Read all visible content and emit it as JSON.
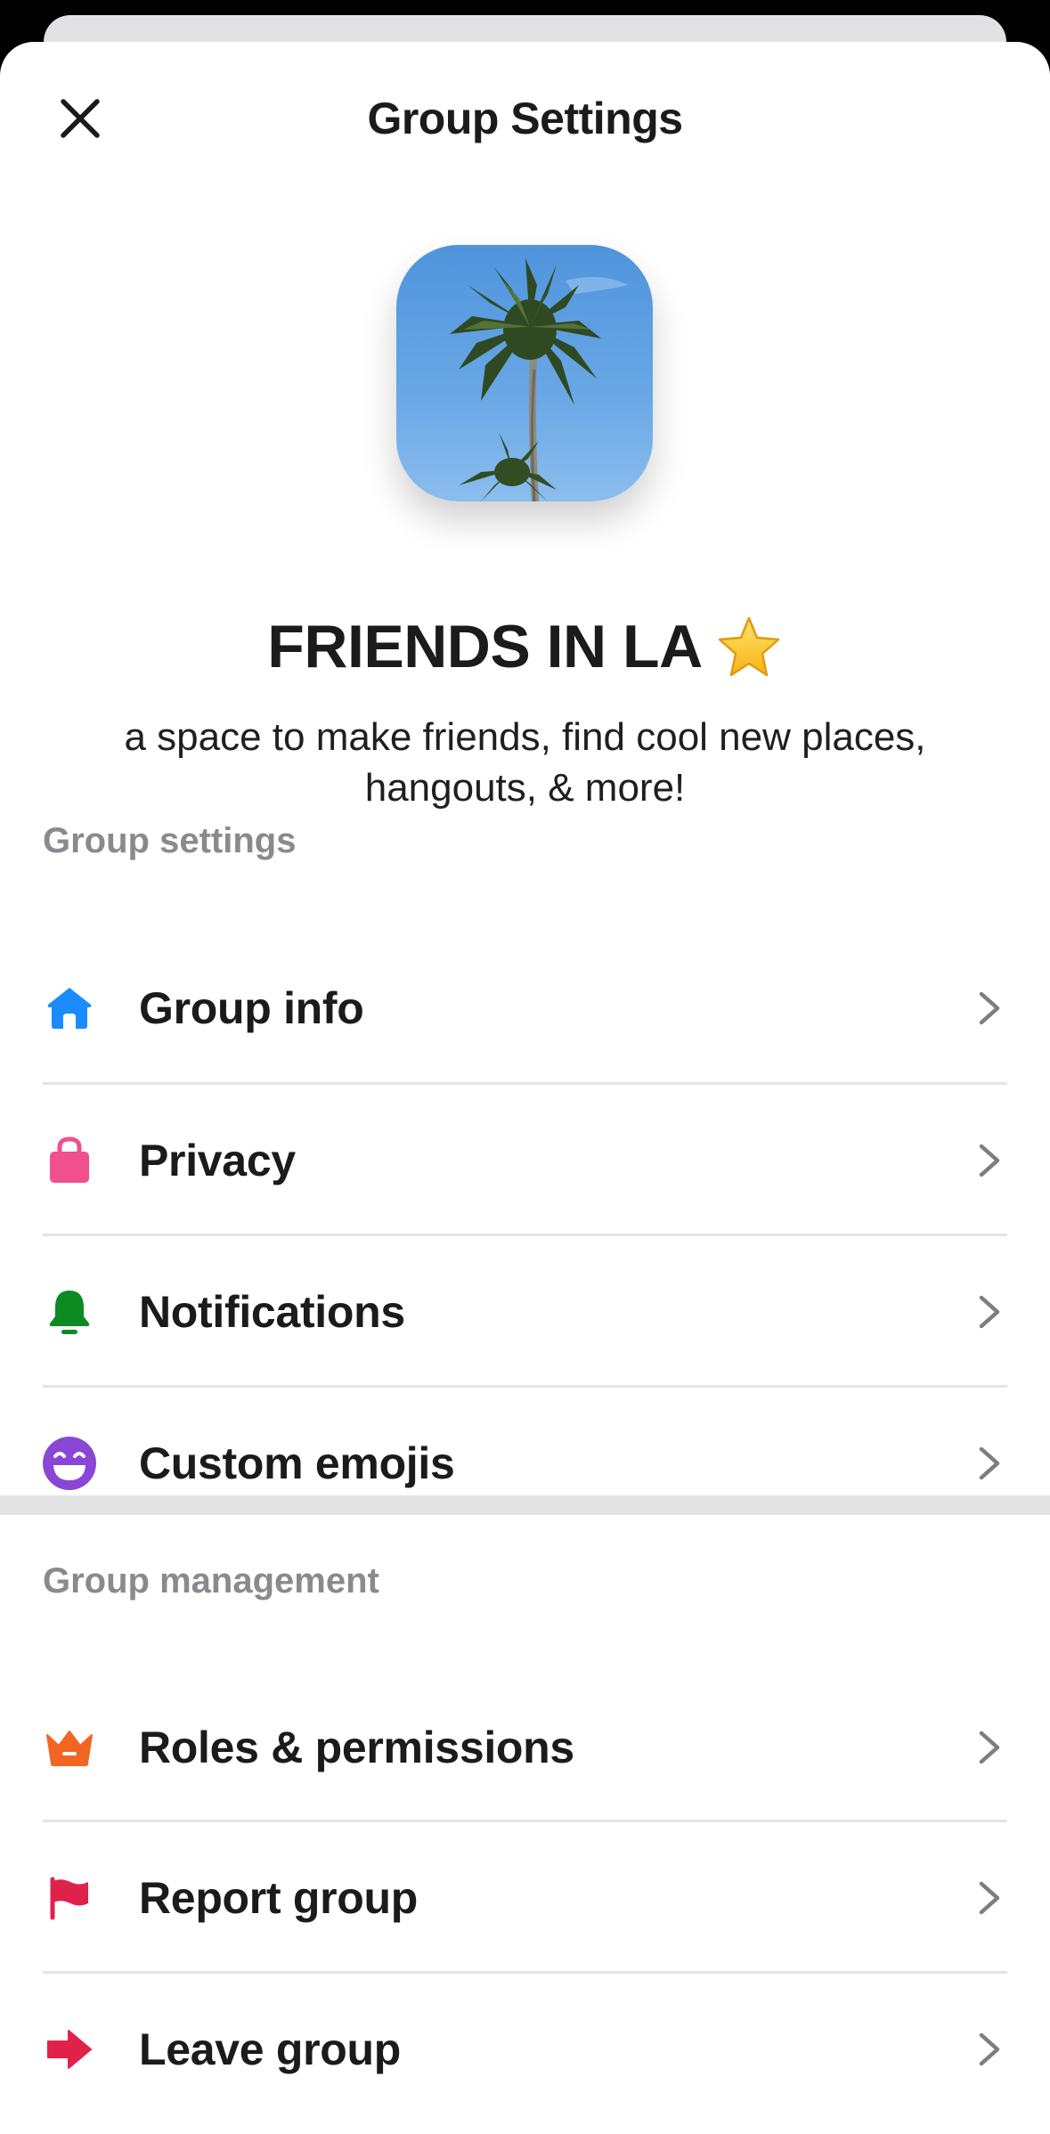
{
  "header": {
    "title": "Group Settings",
    "close_icon": "close-icon"
  },
  "group": {
    "name": "FRIENDS IN LA",
    "name_emoji": "star-icon",
    "description": "a space to make friends, find cool new places, hangouts, & more!",
    "avatar": "palm-tree-photo"
  },
  "settings_section": {
    "label": "Group settings",
    "items": [
      {
        "label": "Group info",
        "icon": "home-icon",
        "color": "#1a8cff"
      },
      {
        "label": "Privacy",
        "icon": "lock-bag-icon",
        "color": "#f0508e"
      },
      {
        "label": "Notifications",
        "icon": "bell-icon",
        "color": "#0d8a22"
      },
      {
        "label": "Custom emojis",
        "icon": "smiley-icon",
        "color": "#8a47d6"
      }
    ]
  },
  "management_section": {
    "label": "Group management",
    "items": [
      {
        "label": "Roles & permissions",
        "icon": "crown-icon",
        "color": "#f26522"
      },
      {
        "label": "Report group",
        "icon": "flag-icon",
        "color": "#e0224a"
      },
      {
        "label": "Leave group",
        "icon": "arrow-right-icon",
        "color": "#e0224a"
      }
    ]
  },
  "colors": {
    "chevron": "#7d7d82",
    "divider": "#e4e4e6",
    "section_label": "#8a8a8e",
    "text": "#1b1b1d"
  }
}
